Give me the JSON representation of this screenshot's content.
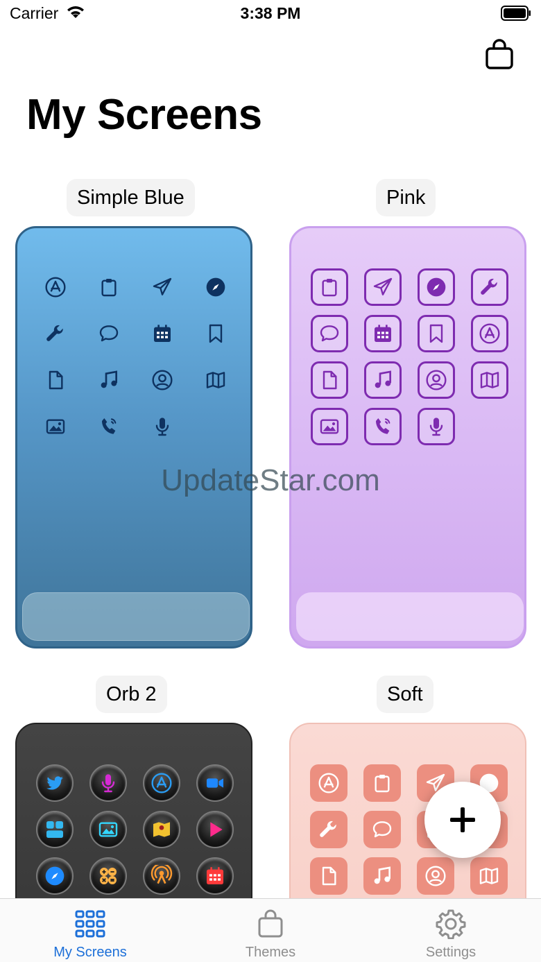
{
  "status_bar": {
    "carrier": "Carrier",
    "time": "3:38 PM"
  },
  "header": {
    "title": "My Screens",
    "cart_icon": "bag-icon"
  },
  "watermark": "UpdateStar.com",
  "screens": [
    {
      "label": "Simple Blue",
      "style": "glyph",
      "icons": [
        "appstore",
        "clipboard",
        "paperplane",
        "compass",
        "wrench",
        "chat",
        "calendar",
        "bookmark",
        "document",
        "music",
        "person",
        "map",
        "photo",
        "phone",
        "mic"
      ]
    },
    {
      "label": "Pink",
      "style": "outlined",
      "icons": [
        "clipboard",
        "paperplane",
        "compass",
        "wrench",
        "chat",
        "calendar",
        "bookmark",
        "appstore",
        "document",
        "music",
        "person",
        "map",
        "photo",
        "phone",
        "mic"
      ]
    },
    {
      "label": "Orb 2",
      "style": "orb",
      "icons": [
        "twitter",
        "mic",
        "appstore",
        "video",
        "widgets",
        "photo",
        "maps",
        "play",
        "compass",
        "calculator",
        "podcast",
        "calendar"
      ]
    },
    {
      "label": "Soft",
      "style": "filled",
      "icons": [
        "appstore",
        "clipboard",
        "paperplane",
        "compass",
        "wrench",
        "chat",
        "calendar",
        "bookmark",
        "document",
        "music",
        "person",
        "map"
      ]
    }
  ],
  "orb_colors": {
    "twitter": "#2a9df4",
    "mic": "#d62ad4",
    "appstore": "#2a9df4",
    "video": "#1e88ff",
    "widgets": "#33b8f0",
    "photo": "#33d6ff",
    "maps": "#f2c230",
    "play": "#ff2b8c",
    "compass": "#1e8bff",
    "calculator": "#ffb347",
    "podcast": "#ff9a2e",
    "calendar": "#ff3a3a"
  },
  "fab": {
    "icon": "plus-icon"
  },
  "tabs": [
    {
      "label": "My Screens",
      "icon": "grid-icon",
      "active": true
    },
    {
      "label": "Themes",
      "icon": "bag-icon",
      "active": false
    },
    {
      "label": "Settings",
      "icon": "gear-icon",
      "active": false
    }
  ]
}
